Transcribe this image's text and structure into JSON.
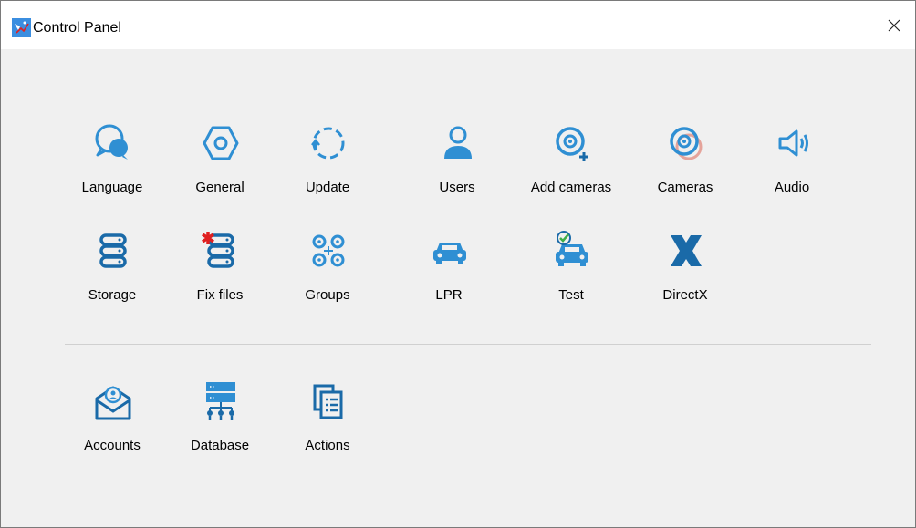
{
  "window": {
    "title": "Control Panel",
    "app_icon": "cctv-app-icon",
    "close_icon": "close-icon"
  },
  "tiles_row1": [
    {
      "label": "Language",
      "icon": "language-icon"
    },
    {
      "label": "General",
      "icon": "hexagon-settings-icon"
    },
    {
      "label": "Update",
      "icon": "update-icon"
    },
    {
      "label": "Users",
      "icon": "user-icon"
    },
    {
      "label": "Add cameras",
      "icon": "add-camera-icon"
    },
    {
      "label": "Cameras",
      "icon": "cameras-icon"
    },
    {
      "label": "Audio",
      "icon": "speaker-icon"
    }
  ],
  "tiles_row2": [
    {
      "label": "Storage",
      "icon": "storage-icon"
    },
    {
      "label": "Fix files",
      "icon": "fix-files-icon"
    },
    {
      "label": "Groups",
      "icon": "groups-icon"
    },
    {
      "label": "LPR",
      "icon": "car-icon"
    },
    {
      "label": "Test",
      "icon": "car-test-icon"
    },
    {
      "label": "DirectX",
      "icon": "directx-icon"
    }
  ],
  "tiles_row3": [
    {
      "label": "Accounts",
      "icon": "mail-account-icon"
    },
    {
      "label": "Database",
      "icon": "database-icon"
    },
    {
      "label": "Actions",
      "icon": "actions-icon"
    }
  ],
  "colors": {
    "accent": "#2f8fd3",
    "dark_accent": "#1a6aa8",
    "red": "#e02020",
    "green": "#3fae49"
  }
}
